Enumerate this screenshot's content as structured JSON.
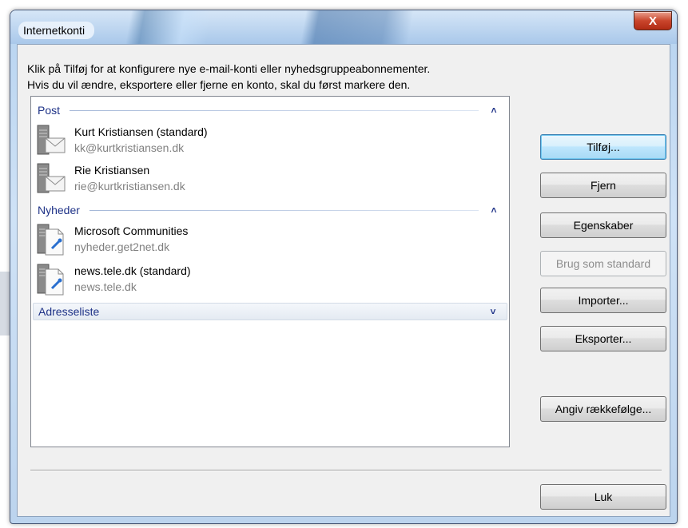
{
  "window": {
    "title": "Internetkonti",
    "close_glyph": "X"
  },
  "intro": {
    "line1": "Klik på Tilføj for at konfigurere nye e-mail-konti eller nyhedsgruppeabonnementer.",
    "line2": "Hvis du vil ændre, eksportere eller fjerne en konto, skal du først markere den."
  },
  "groups": {
    "post": {
      "label": "Post",
      "state": "expanded",
      "chevron": "^",
      "items": [
        {
          "name": "Kurt Kristiansen (standard)",
          "detail": "kk@kurtkristiansen.dk",
          "icon": "mail-account-icon"
        },
        {
          "name": "Rie Kristiansen",
          "detail": "rie@kurtkristiansen.dk",
          "icon": "mail-account-icon"
        }
      ]
    },
    "nyheder": {
      "label": "Nyheder",
      "state": "expanded",
      "chevron": "^",
      "items": [
        {
          "name": "Microsoft Communities",
          "detail": "nyheder.get2net.dk",
          "icon": "news-account-icon"
        },
        {
          "name": "news.tele.dk (standard)",
          "detail": "news.tele.dk",
          "icon": "news-account-icon"
        }
      ]
    },
    "adresseliste": {
      "label": "Adresseliste",
      "state": "collapsed",
      "chevron": "v"
    }
  },
  "buttons": {
    "add": "Tilføj...",
    "remove": "Fjern",
    "properties": "Egenskaber",
    "set_default": "Brug som standard",
    "import": "Importer...",
    "export": "Eksporter...",
    "order": "Angiv rækkefølge...",
    "close": "Luk"
  },
  "colors": {
    "group_header": "#1e3287",
    "detail_text": "#808080",
    "close_button": "#c9452c",
    "default_button": "#a7d9f5"
  }
}
